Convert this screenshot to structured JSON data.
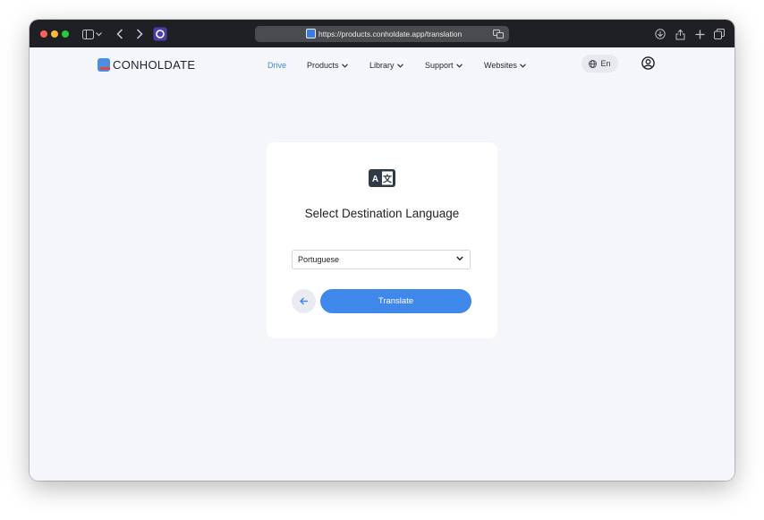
{
  "browser": {
    "url": "https://products.conholdate.app/translation",
    "colors": {
      "close": "#ff5f57",
      "minimize": "#febc2e",
      "zoom": "#28c840"
    }
  },
  "header": {
    "logo_text": "CONHOLDATE",
    "nav": [
      {
        "label": "Drive",
        "active": true
      },
      {
        "label": "Products",
        "has_dropdown": true
      },
      {
        "label": "Library",
        "has_dropdown": true
      },
      {
        "label": "Support",
        "has_dropdown": true
      },
      {
        "label": "Websites",
        "has_dropdown": true
      }
    ],
    "language": "En",
    "accent": "#3f86d7"
  },
  "card": {
    "icon": "translate-icon",
    "title": "Select Destination Language",
    "select": {
      "value": "Portuguese"
    },
    "back_icon": "arrow-left-icon",
    "translate_label": "Translate",
    "button_color": "#3f87e8"
  }
}
